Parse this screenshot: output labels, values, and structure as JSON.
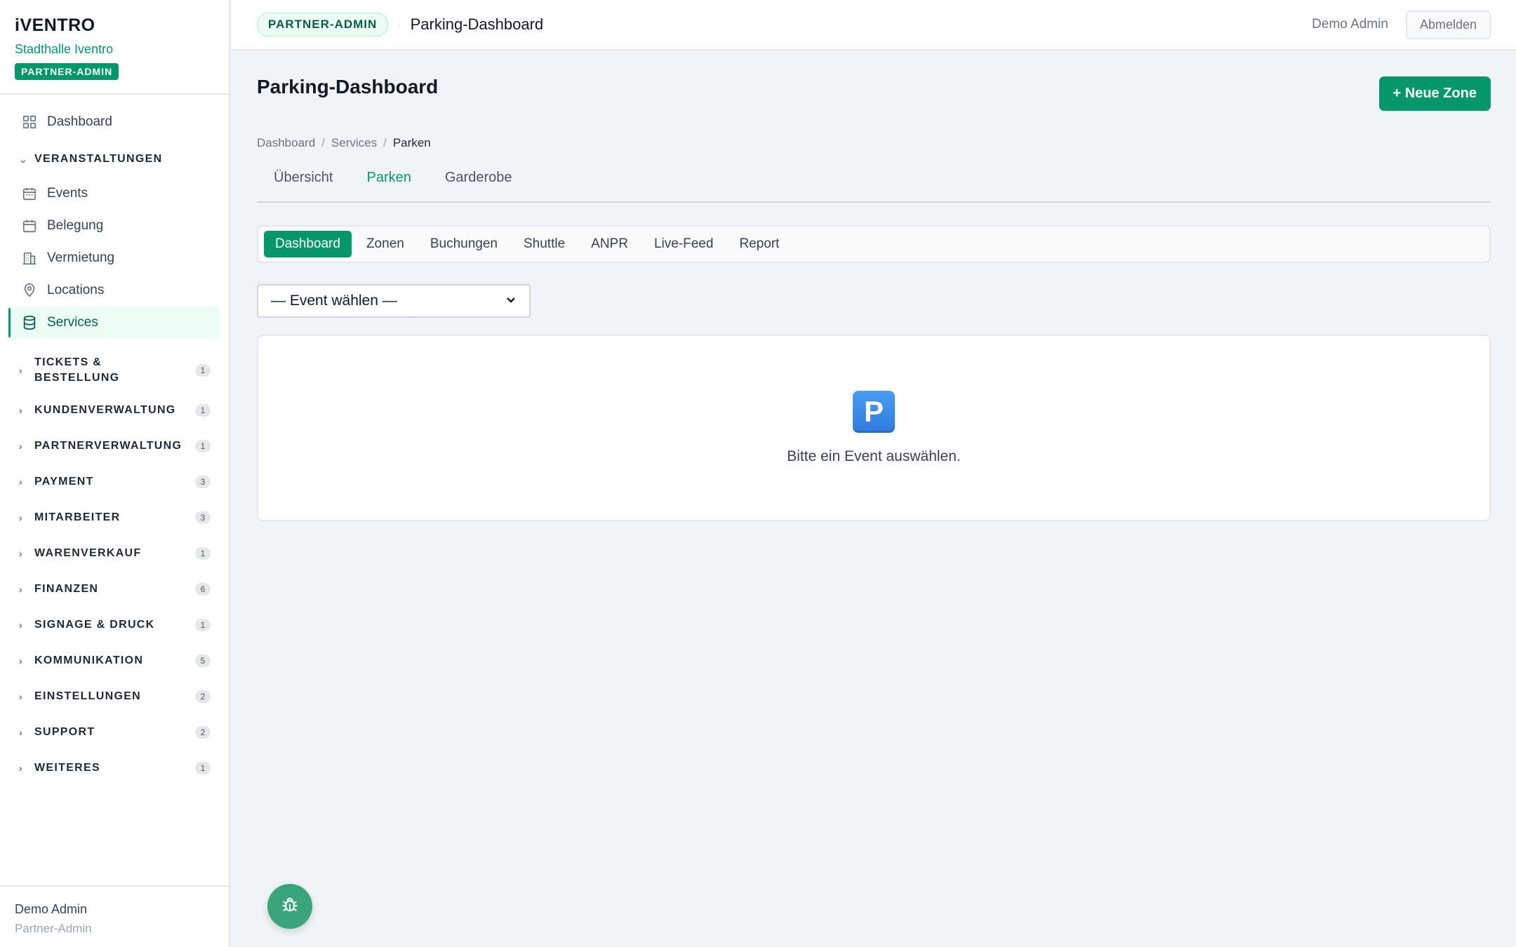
{
  "brand": {
    "logo": "iVENTRO",
    "org": "Stadthalle Iventro",
    "badge": "PARTNER-ADMIN"
  },
  "sidebar": {
    "dashboard": "Dashboard",
    "group_veranstaltungen": "VERANSTALTUNGEN",
    "items": [
      {
        "label": "Events",
        "icon": "calendar-icon"
      },
      {
        "label": "Belegung",
        "icon": "calendar-icon"
      },
      {
        "label": "Vermietung",
        "icon": "building-icon"
      },
      {
        "label": "Locations",
        "icon": "map-pin-icon"
      },
      {
        "label": "Services",
        "icon": "database-icon",
        "active": true
      }
    ],
    "groups": [
      {
        "label": "TICKETS & BESTELLUNG",
        "count": "1"
      },
      {
        "label": "KUNDENVERWALTUNG",
        "count": "1"
      },
      {
        "label": "PARTNERVERWALTUNG",
        "count": "1"
      },
      {
        "label": "PAYMENT",
        "count": "3"
      },
      {
        "label": "MITARBEITER",
        "count": "3"
      },
      {
        "label": "WARENVERKAUF",
        "count": "1"
      },
      {
        "label": "FINANZEN",
        "count": "6"
      },
      {
        "label": "SIGNAGE & DRUCK",
        "count": "1"
      },
      {
        "label": "KOMMUNIKATION",
        "count": "5"
      },
      {
        "label": "EINSTELLUNGEN",
        "count": "2"
      },
      {
        "label": "SUPPORT",
        "count": "2"
      },
      {
        "label": "WEITERES",
        "count": "1"
      }
    ],
    "footer": {
      "name": "Demo Admin",
      "role": "Partner-Admin"
    }
  },
  "topbar": {
    "badge": "PARTNER-ADMIN",
    "separator": "·",
    "title": "Parking-Dashboard",
    "user": "Demo Admin",
    "logout": "Abmelden"
  },
  "main": {
    "title": "Parking-Dashboard",
    "new_zone_button": "+ Neue Zone",
    "breadcrumb": [
      "Dashboard",
      "Services",
      "Parken"
    ],
    "breadcrumb_sep": "/",
    "tabs": [
      "Übersicht",
      "Parken",
      "Garderobe"
    ],
    "active_tab": "Parken",
    "subtabs": [
      "Dashboard",
      "Zonen",
      "Buchungen",
      "Shuttle",
      "ANPR",
      "Live-Feed",
      "Report"
    ],
    "active_subtab": "Dashboard",
    "event_select": "— Event wählen —",
    "empty_icon_letter": "P",
    "empty_text": "Bitte ein Event auswählen."
  },
  "colors": {
    "accent": "#059669",
    "background": "#f0f4f8"
  }
}
